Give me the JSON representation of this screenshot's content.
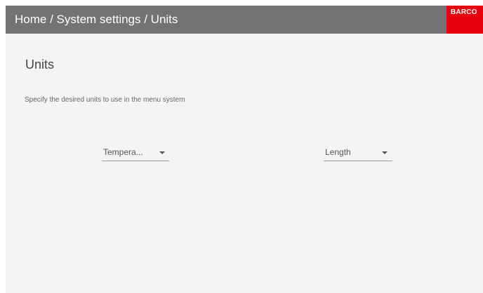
{
  "header": {
    "breadcrumb": "Home / System settings / Units",
    "logo_text": "BARCO",
    "colors": {
      "bar": "#737373",
      "logo_bg": "#e9000d"
    }
  },
  "main": {
    "title": "Units",
    "description": "Specify the desired units to use in the menu system"
  },
  "selects": {
    "temperature": {
      "label": "Tempera...",
      "icon": "chevron-down-icon"
    },
    "length": {
      "label": "Length",
      "icon": "chevron-down-icon"
    }
  }
}
